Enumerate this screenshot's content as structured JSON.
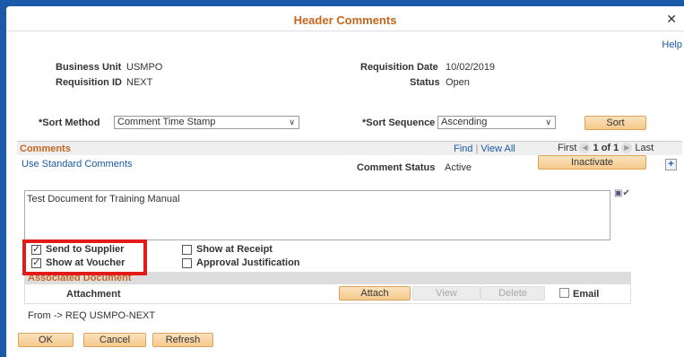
{
  "dialog": {
    "title": "Header Comments",
    "help_label": "Help"
  },
  "header": {
    "business_unit_label": "Business Unit",
    "business_unit_value": "USMPO",
    "requisition_id_label": "Requisition ID",
    "requisition_id_value": "NEXT",
    "requisition_date_label": "Requisition Date",
    "requisition_date_value": "10/02/2019",
    "status_label": "Status",
    "status_value": "Open"
  },
  "sort": {
    "method_label": "*Sort Method",
    "method_value": "Comment Time Stamp",
    "sequence_label": "*Sort Sequence",
    "sequence_value": "Ascending",
    "sort_button": "Sort"
  },
  "comments": {
    "section_title": "Comments",
    "find_label": "Find",
    "separator": "|",
    "view_all_label": "View All",
    "first_label": "First",
    "pager_text": "1 of 1",
    "last_label": "Last",
    "use_standard_label": "Use Standard Comments",
    "comment_status_label": "Comment Status",
    "comment_status_value": "Active",
    "inactivate_button": "Inactivate",
    "comment_text": "Test Document for Training Manual"
  },
  "checkboxes": {
    "send_to_supplier": {
      "label": "Send to Supplier",
      "checked": true
    },
    "show_at_voucher": {
      "label": "Show at Voucher",
      "checked": true
    },
    "show_at_receipt": {
      "label": "Show at Receipt",
      "checked": false
    },
    "approval_justification": {
      "label": "Approval Justification",
      "checked": false
    }
  },
  "associated": {
    "title": "Associated Document",
    "attachment_label": "Attachment",
    "attach_button": "Attach",
    "view_button": "View",
    "delete_button": "Delete",
    "email_label": "Email"
  },
  "footer": {
    "from_text": "From -> REQ USMPO-NEXT",
    "ok_button": "OK",
    "cancel_button": "Cancel",
    "refresh_button": "Refresh"
  },
  "colors": {
    "accent": "#c6651e",
    "link": "#1a5aa8",
    "highlight": "#e31a1a",
    "frame": "#1a5aa8"
  }
}
